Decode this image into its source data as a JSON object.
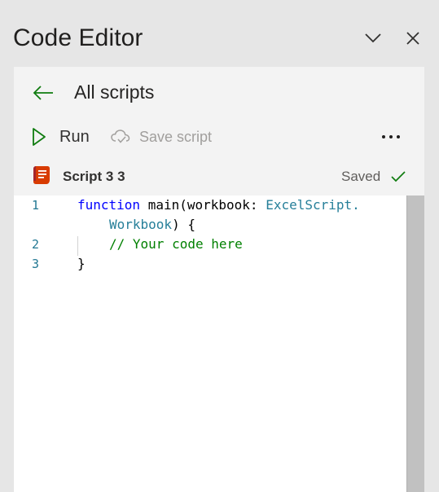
{
  "pane": {
    "title": "Code Editor",
    "collapse_icon": "chevron-down-icon",
    "close_icon": "close-icon"
  },
  "nav": {
    "back_icon": "arrow-left-icon",
    "back_label": "All scripts"
  },
  "toolbar": {
    "run_label": "Run",
    "run_icon": "play-icon",
    "save_label": "Save script",
    "save_icon": "cloud-save-icon",
    "more_icon": "more-options-icon"
  },
  "script": {
    "name": "Script 3 3",
    "status": "Saved",
    "status_icon": "checkmark-icon",
    "file_icon": "script-icon"
  },
  "editor": {
    "line_numbers": [
      "1",
      "2",
      "3"
    ],
    "code": {
      "l1_kw": "function",
      "l1_fn": " main(workbook: ",
      "l1_type": "ExcelScript.",
      "l1b_type": "Workbook",
      "l1b_rest": ") {",
      "l2_comment": "// Your code here",
      "l3": "}"
    }
  },
  "colors": {
    "accent_green": "#107c10",
    "script_icon_orange": "#d83b01",
    "line_number": "#237893",
    "keyword": "#0000ff",
    "type": "#267f99",
    "comment": "#008000"
  }
}
